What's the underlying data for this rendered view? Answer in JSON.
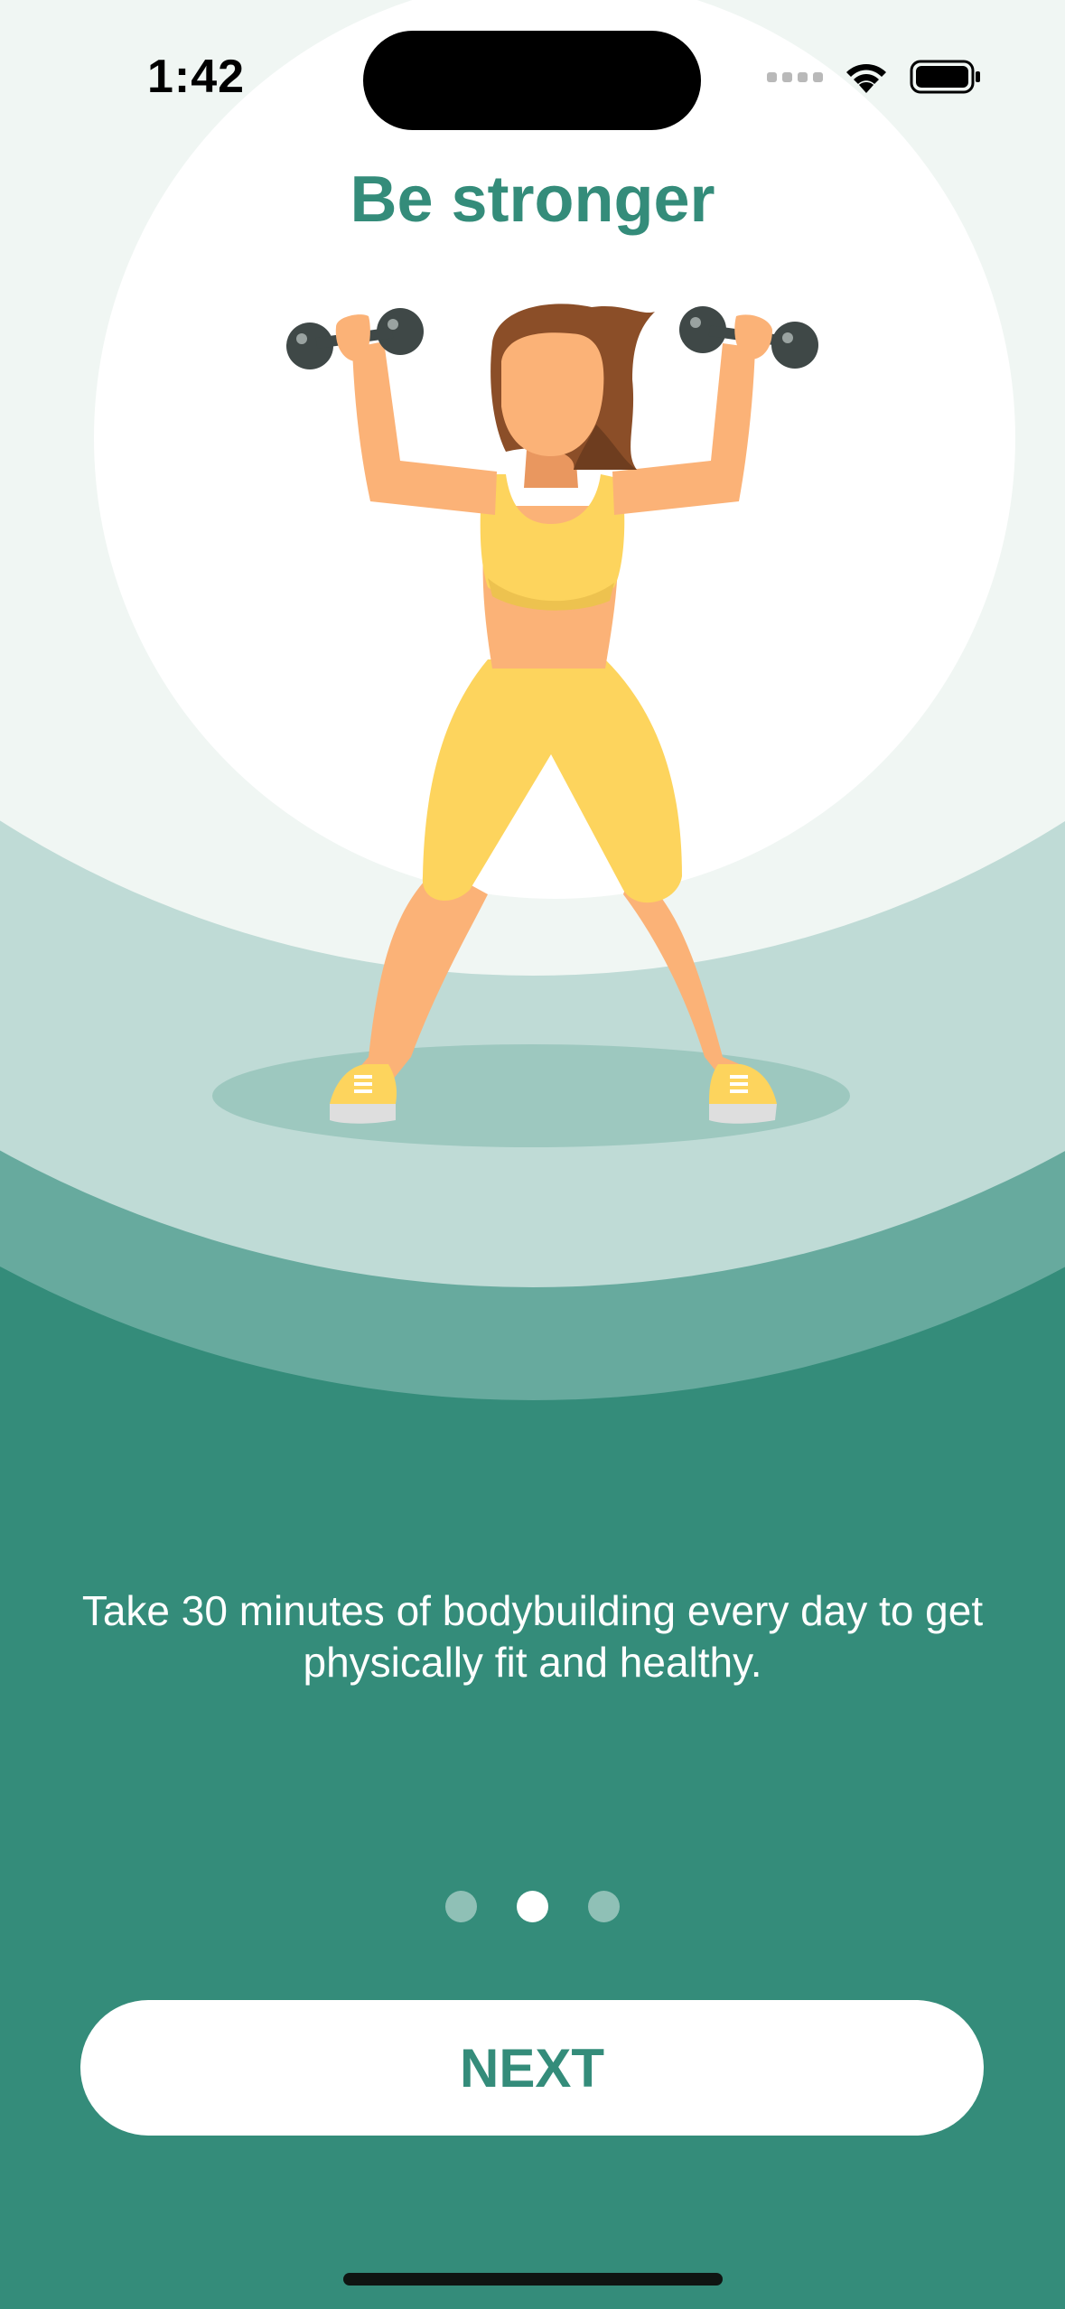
{
  "status_bar": {
    "time": "1:42",
    "wifi_icon": "wifi-icon",
    "battery_icon": "battery-icon"
  },
  "onboarding": {
    "title": "Be stronger",
    "caption": "Take 30 minutes of bodybuilding every day to get physically fit and healthy.",
    "page_indicator": {
      "total": 3,
      "current_index": 1
    },
    "next_label": "NEXT"
  },
  "illustration": {
    "subject": "woman-lifting-dumbbells"
  },
  "colors": {
    "brand_green": "#348c7a",
    "mid_green": "#67aa9e",
    "light_green": "#bfdbd6",
    "background_light": "#f0f6f3",
    "outfit_yellow": "#fdd45d",
    "skin": "#fbb277",
    "hair": "#8b4e28",
    "dumbbell": "#3f4847"
  }
}
